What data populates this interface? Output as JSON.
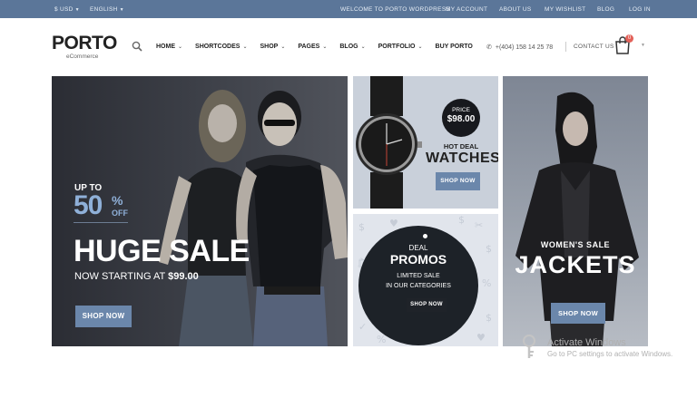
{
  "topbar": {
    "currency": "$ USD",
    "language": "ENGLISH",
    "links": [
      "WELCOME TO PORTO WORDPRESS",
      "MY ACCOUNT",
      "ABOUT US",
      "MY WISHLIST",
      "BLOG",
      "LOG IN"
    ]
  },
  "header": {
    "logo": "PORTO",
    "logo_sub": "eCommerce",
    "nav": [
      "HOME",
      "SHORTCODES",
      "SHOP",
      "PAGES",
      "BLOG",
      "PORTFOLIO",
      "BUY PORTO"
    ],
    "phone": "+(404) 158 14 25 78",
    "contact": "CONTACT US",
    "cart_count": "0"
  },
  "banner_main": {
    "up_to": "UP TO",
    "percent_value": "50",
    "percent_sign": "%",
    "off": "OFF",
    "headline": "HUGE SALE",
    "starting_prefix": "NOW STARTING AT ",
    "starting_price": "$99.00",
    "button": "SHOP NOW"
  },
  "banner_watch": {
    "price_label": "PRICE",
    "price": "$98.00",
    "hot_deal": "HOT DEAL",
    "title": "WATCHES",
    "button": "SHOP NOW"
  },
  "banner_promo": {
    "deal": "DEAL",
    "title": "PROMOS",
    "line1": "LIMITED SALE",
    "line2": "IN OUR CATEGORIES",
    "button": "SHOP NOW"
  },
  "banner_jacket": {
    "subtitle": "WOMEN'S SALE",
    "title": "JACKETS",
    "button": "SHOP NOW"
  },
  "watermark": {
    "title": "Activate Windows",
    "subtitle": "Go to PC settings to activate Windows."
  },
  "colors": {
    "topbar": "#5b7699",
    "button": "#6b87ab",
    "accent_blue": "#8fb0d8",
    "badge": "#e36159"
  }
}
